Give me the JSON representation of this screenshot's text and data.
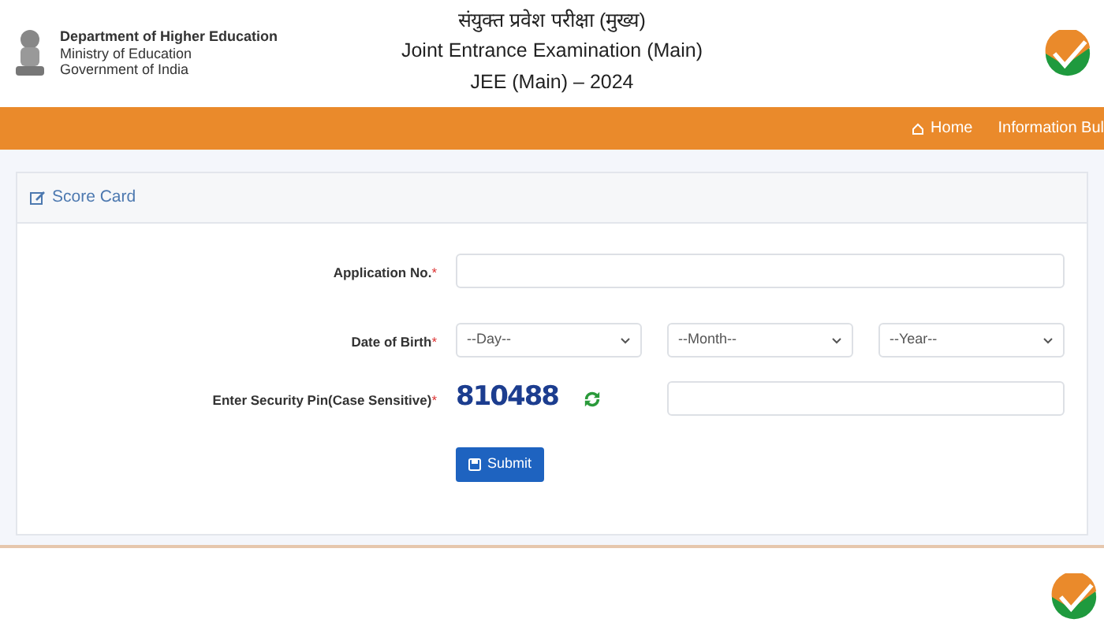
{
  "header": {
    "department": "Department of Higher Education",
    "ministry": "Ministry of Education",
    "government": "Government of India",
    "title_hindi": "संयुक्त प्रवेश परीक्षा (मुख्य)",
    "title": "Joint Entrance Examination (Main)",
    "subtitle": "JEE (Main) – 2024"
  },
  "nav": [
    {
      "label": "Home",
      "kind": "iconlink"
    },
    {
      "label": "Information Bul",
      "kind": "textlink"
    }
  ],
  "card": {
    "title": "Score Card",
    "fields": [
      {
        "kind": "text",
        "label": "Application No.",
        "mark": "*"
      },
      {
        "kind": "selects",
        "label": "Date of Birth",
        "mark": "*",
        "selects": [
          "--Day--",
          "--Month--",
          "--Year--"
        ]
      },
      {
        "kind": "captcha",
        "label": "Enter Security Pin(Case Sensitive)",
        "mark": "*",
        "captcha": "810488"
      }
    ],
    "submit": "Submit"
  }
}
